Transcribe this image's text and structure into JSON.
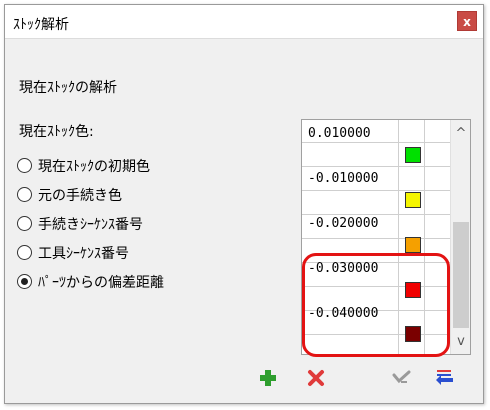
{
  "window": {
    "title": "ｽﾄｯｸ解析",
    "close_glyph": "x"
  },
  "heading": "現在ｽﾄｯｸの解析",
  "color_label": "現在ｽﾄｯｸ色:",
  "options": [
    {
      "label": "現在ｽﾄｯｸの初期色",
      "checked": false
    },
    {
      "label": "元の手続き色",
      "checked": false
    },
    {
      "label": "手続きｼｰｹﾝｽ番号",
      "checked": false
    },
    {
      "label": "工具ｼｰｹﾝｽ番号",
      "checked": false
    },
    {
      "label": "ﾊﾟｰﾂからの偏差距離",
      "checked": true
    }
  ],
  "color_table": [
    {
      "value": "0.010000",
      "color": "#00e000"
    },
    {
      "value": "-0.010000",
      "color": "#f5f500"
    },
    {
      "value": "-0.020000",
      "color": "#f5a000"
    },
    {
      "value": "-0.030000",
      "color": "#f00000"
    },
    {
      "value": "-0.040000",
      "color": "#7a0000"
    }
  ],
  "scrollbar": {
    "up_glyph": "^",
    "down_glyph": "v"
  },
  "toolbar": {
    "add_icon": "plus-icon",
    "delete_icon": "x-icon",
    "apply_icon": "check-icon",
    "transfer_icon": "transfer-icon"
  },
  "colors": {
    "highlight": "#e31313",
    "add": "#2e9e2e",
    "delete": "#e03a3a",
    "transfer": "#2a4fd0"
  }
}
